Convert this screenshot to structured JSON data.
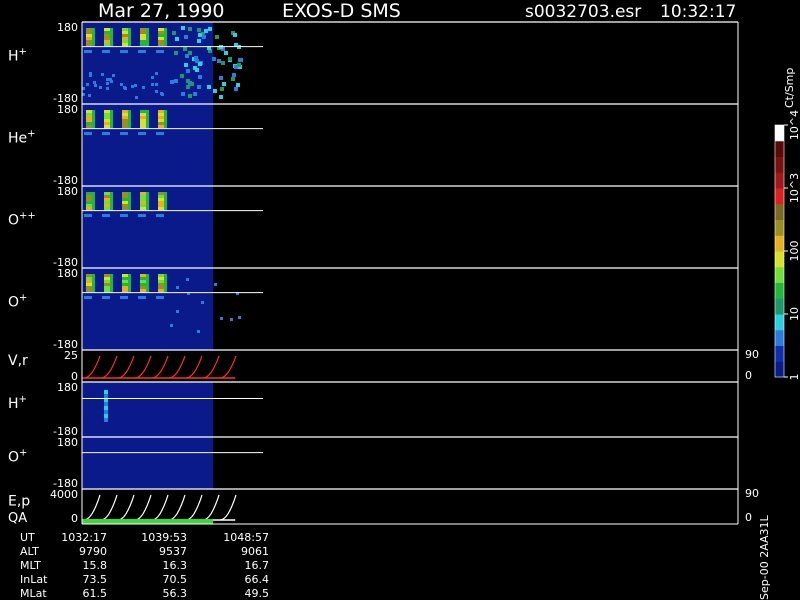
{
  "header": {
    "date": "Mar 27, 1990",
    "instrument": "EXOS-D SMS",
    "file": "s0032703.esr",
    "time": "10:32:17"
  },
  "colorbar": {
    "unit_label": "Ct/Smp",
    "ticks": [
      {
        "label": "1",
        "level": 0.0
      },
      {
        "label": "10",
        "level": 0.25
      },
      {
        "label": "100",
        "level": 0.5
      },
      {
        "label": "10^3",
        "level": 0.75
      },
      {
        "label": "10^4",
        "level": 1.0
      }
    ],
    "colors": [
      "#0a1a8a",
      "#0d2fb0",
      "#2a7de0",
      "#2ad0e0",
      "#1a9a6a",
      "#1fb83a",
      "#6fe03a",
      "#d8e02a",
      "#e6b020",
      "#9a9020",
      "#7a6a20",
      "#e02020",
      "#a01818",
      "#7a1010",
      "#5a0808",
      "#ffffff"
    ]
  },
  "chart_data": {
    "type": "heatmap",
    "time_axis": {
      "start": "10:32:17",
      "end": "10:48:57",
      "data_end_fraction": 0.2
    },
    "panels": [
      {
        "id": "H+",
        "label": "H",
        "sup": "+",
        "ylim": [
          -180,
          180
        ],
        "tick_top": "180",
        "tick_bottom": "-180",
        "style": "hplus"
      },
      {
        "id": "He+",
        "label": "He",
        "sup": "+",
        "ylim": [
          -180,
          180
        ],
        "tick_top": "180",
        "tick_bottom": "-180",
        "style": "periodic"
      },
      {
        "id": "O++",
        "label": "O",
        "sup": "++",
        "ylim": [
          -180,
          180
        ],
        "tick_top": "180",
        "tick_bottom": "-180",
        "style": "periodic"
      },
      {
        "id": "O+",
        "label": "O",
        "sup": "+",
        "ylim": [
          -180,
          180
        ],
        "tick_top": "180",
        "tick_bottom": "-180",
        "style": "oplus"
      },
      {
        "id": "Vr",
        "label": "V,r",
        "sup": "",
        "ylim": [
          0,
          25
        ],
        "tick_top": "25",
        "tick_bottom": "0",
        "right_top": "90",
        "right_bottom": "0",
        "style": "line-red"
      },
      {
        "id": "H+2",
        "label": "H",
        "sup": "+",
        "ylim": [
          -180,
          180
        ],
        "tick_top": "180",
        "tick_bottom": "-180",
        "style": "sparse"
      },
      {
        "id": "O+2",
        "label": "O",
        "sup": "+",
        "ylim": [
          -180,
          180
        ],
        "tick_top": "180",
        "tick_bottom": "-180",
        "style": "empty"
      },
      {
        "id": "Ep",
        "label": "E,p",
        "sup": "",
        "label2": "QA",
        "ylim": [
          0,
          4000
        ],
        "tick_top": "4000",
        "tick_bottom": "0",
        "right_top": "90",
        "right_bottom": "0",
        "style": "line-white"
      }
    ]
  },
  "ephemeris": {
    "rows": [
      {
        "label": "UT",
        "values": [
          "1032:17",
          "1039:53",
          "1048:57"
        ]
      },
      {
        "label": "ALT",
        "values": [
          "9790",
          "9537",
          "9061"
        ]
      },
      {
        "label": "MLT",
        "values": [
          "15.8",
          "16.3",
          "16.7"
        ]
      },
      {
        "label": "InLat",
        "values": [
          "73.5",
          "70.5",
          "66.4"
        ]
      },
      {
        "label": "MLat",
        "values": [
          "61.5",
          "56.3",
          "49.5"
        ]
      }
    ]
  },
  "footer_note": "Sep-00 2AA31L"
}
